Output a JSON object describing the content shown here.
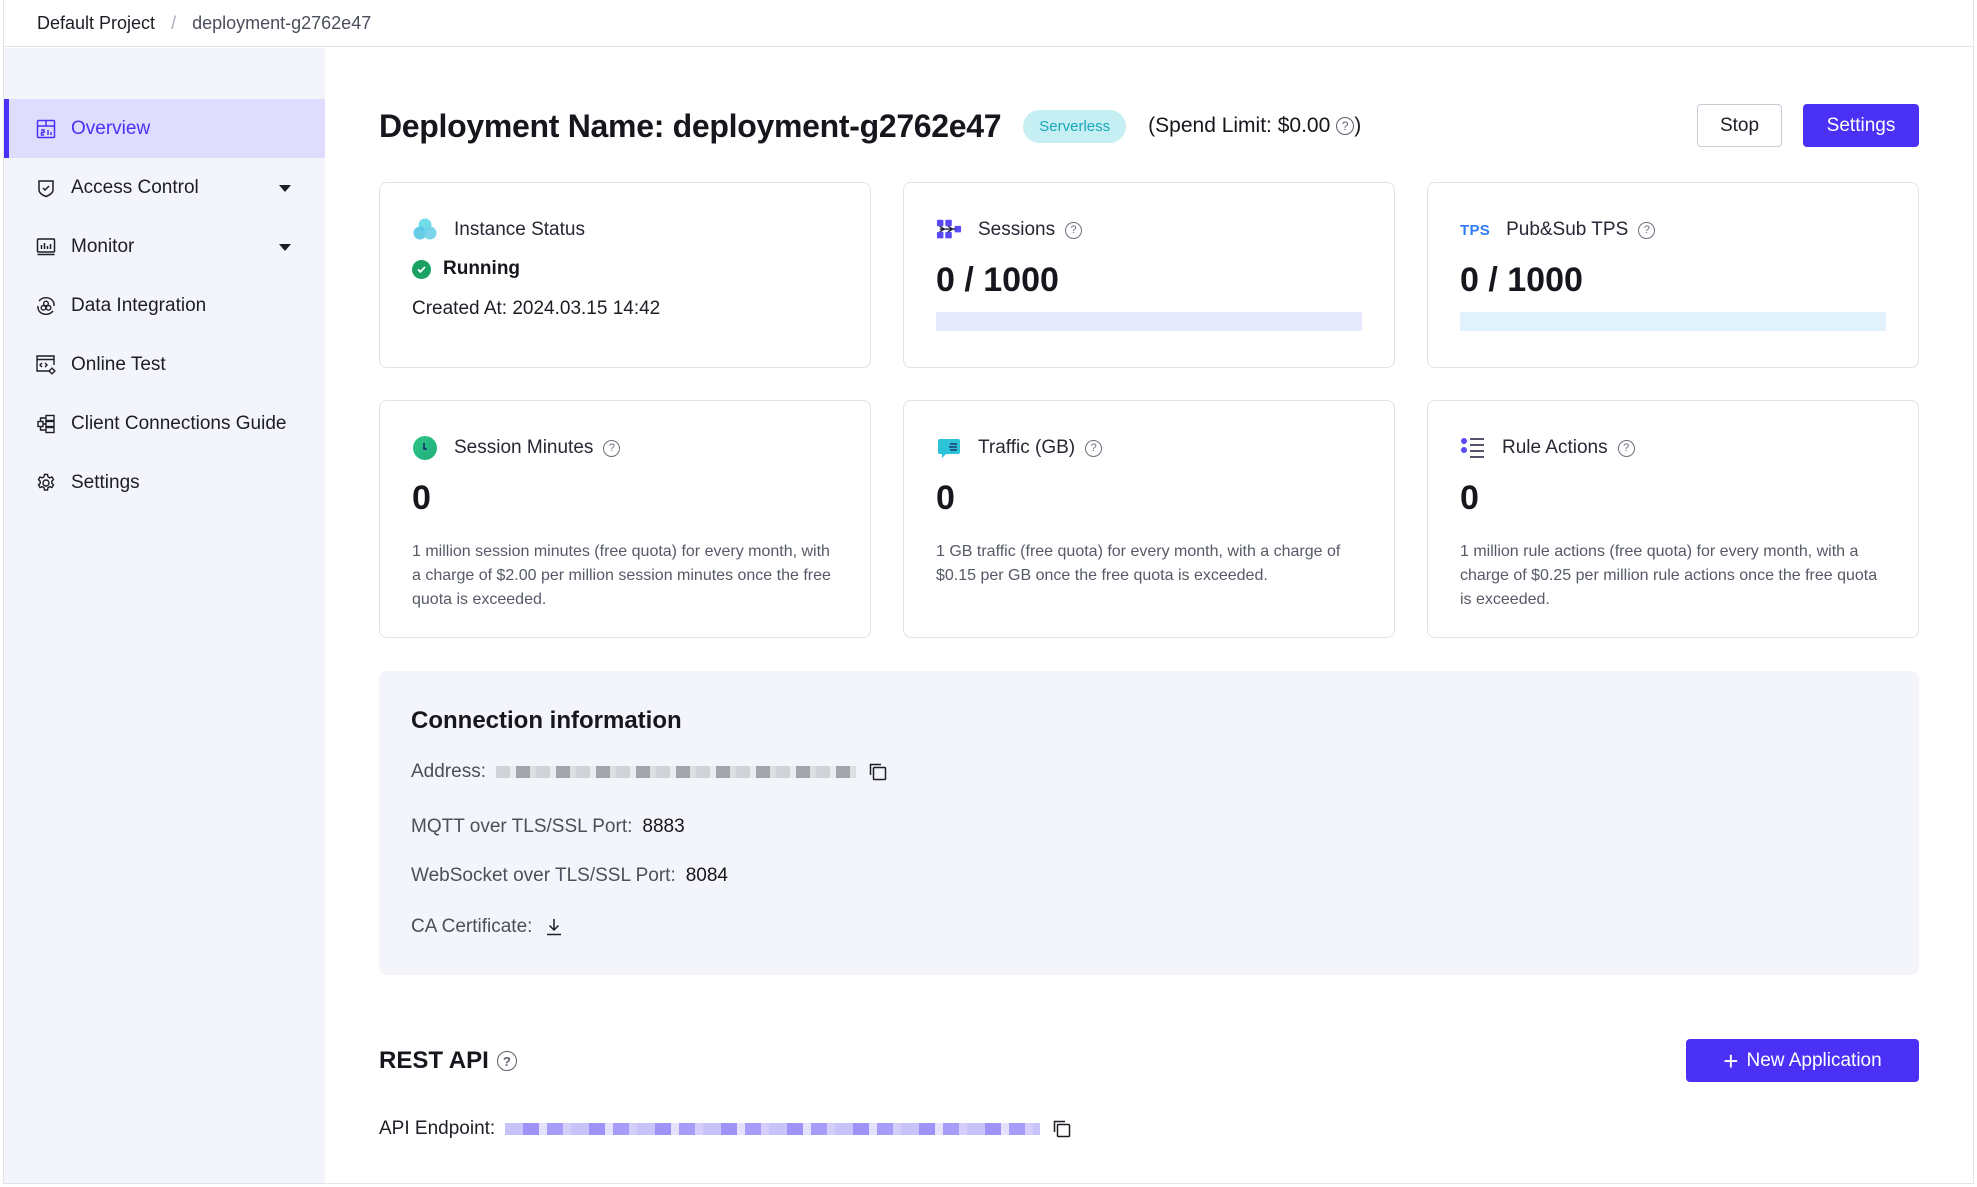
{
  "breadcrumb": {
    "root": "Default Project",
    "separator": "/",
    "current": "deployment-g2762e47"
  },
  "sidebar": {
    "items": [
      {
        "label": "Overview",
        "icon": "dashboard-icon",
        "active": true
      },
      {
        "label": "Access Control",
        "icon": "shield-check-icon",
        "expandable": true
      },
      {
        "label": "Monitor",
        "icon": "monitor-chart-icon",
        "expandable": true
      },
      {
        "label": "Data Integration",
        "icon": "integration-icon"
      },
      {
        "label": "Online Test",
        "icon": "code-window-gear-icon"
      },
      {
        "label": "Client Connections Guide",
        "icon": "connections-guide-icon"
      },
      {
        "label": "Settings",
        "icon": "gear-icon"
      }
    ]
  },
  "header": {
    "title": "Deployment Name: deployment-g2762e47",
    "badge": "Serverless",
    "spend_limit": "(Spend Limit: $0.00",
    "spend_close": ")",
    "help_glyph": "?",
    "stop_label": "Stop",
    "settings_label": "Settings"
  },
  "cards": {
    "instance": {
      "title": "Instance Status",
      "status": "Running",
      "created": "Created At: 2024.03.15 14:42"
    },
    "sessions": {
      "title": "Sessions",
      "value": "0 / 1000",
      "progress_fraction": 0
    },
    "tps": {
      "icon_text": "TPS",
      "title": "Pub&Sub TPS",
      "value": "0 / 1000",
      "progress_fraction": 0
    },
    "session_minutes": {
      "title": "Session Minutes",
      "value": "0",
      "desc": "1 million session minutes (free quota) for every month, with a charge of $2.00 per million session minutes once the free quota is exceeded."
    },
    "traffic": {
      "title": "Traffic (GB)",
      "value": "0",
      "desc": "1 GB traffic (free quota) for every month, with a charge of $0.15 per GB once the free quota is exceeded."
    },
    "rule_actions": {
      "title": "Rule Actions",
      "value": "0",
      "desc": "1 million rule actions (free quota) for every month, with a charge of $0.25 per million rule actions once the free quota is exceeded."
    }
  },
  "connection": {
    "title": "Connection information",
    "address_label": "Address:",
    "mqtt_label": "MQTT over TLS/SSL Port:",
    "mqtt_port": "8883",
    "ws_label": "WebSocket over TLS/SSL Port:",
    "ws_port": "8084",
    "ca_label": "CA Certificate:"
  },
  "rest_api": {
    "title": "REST API",
    "new_app_label": "New Application",
    "endpoint_label": "API Endpoint:"
  },
  "colors": {
    "primary": "#4a31f5",
    "success": "#1aa265",
    "badge_bg": "#c6eff3",
    "badge_text": "#17a7b8",
    "sidebar_bg": "#f4f5fa",
    "sidebar_active_bg": "#dfdcfd"
  }
}
